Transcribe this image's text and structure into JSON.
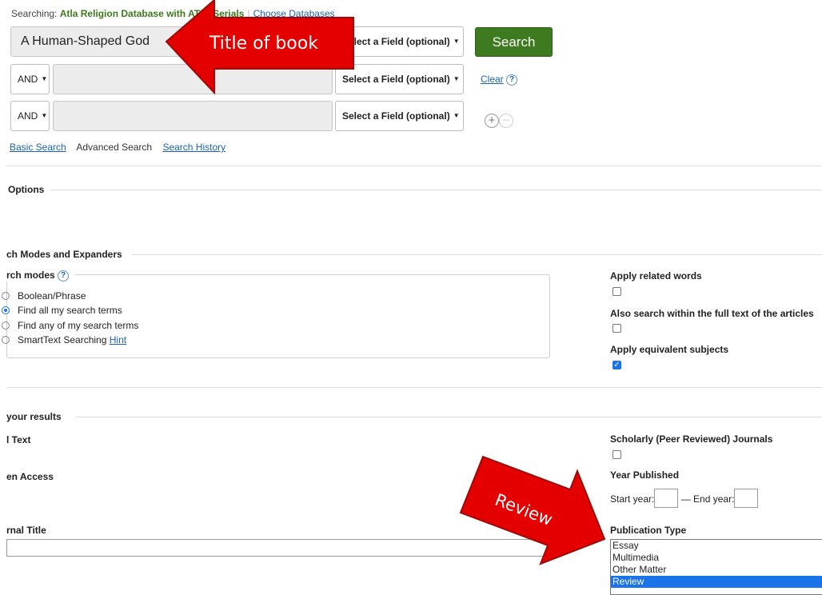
{
  "search_header": {
    "prefix": "Searching:",
    "database": "Atla Religion Database with ATLASerials",
    "choose_databases": "Choose Databases"
  },
  "rows": [
    {
      "term": "A Human-Shaped God",
      "field": "Select a Field (optional)"
    },
    {
      "operator": "AND",
      "term": "",
      "field": "Select a Field (optional)"
    },
    {
      "operator": "AND",
      "term": "",
      "field": "Select a Field (optional)"
    }
  ],
  "search_button": "Search",
  "clear_link": "Clear",
  "help_glyph": "?",
  "add_glyph": "+",
  "remove_glyph": "−",
  "caret_glyph": "▼",
  "nav": {
    "basic": "Basic Search",
    "advanced": "Advanced Search",
    "history": "Search History"
  },
  "options_heading": "Options",
  "modes_heading": "ch Modes and Expanders",
  "search_modes_label": "rch modes",
  "modes": [
    {
      "label": "Boolean/Phrase",
      "selected": false
    },
    {
      "label": "Find all my search terms",
      "selected": true
    },
    {
      "label": "Find any of my search terms",
      "selected": false
    },
    {
      "label": "SmartText Searching",
      "selected": false,
      "hint": "Hint"
    }
  ],
  "expanders": [
    {
      "label": "Apply related words",
      "checked": false
    },
    {
      "label": "Also search within the full text of the articles",
      "checked": false
    },
    {
      "label": "Apply equivalent subjects",
      "checked": true
    }
  ],
  "limit_heading": "your results",
  "limiters_left": {
    "full_text": "l Text",
    "open_access": "en Access",
    "journal_title": "rnal Title"
  },
  "scholarly": {
    "label": "Scholarly (Peer Reviewed) Journals",
    "checked": false
  },
  "year_published": {
    "label": "Year Published",
    "start": "Start year:",
    "end": "— End year:"
  },
  "publication_type": {
    "label": "Publication Type",
    "options": [
      "Essay",
      "Multimedia",
      "Other Matter",
      "Review"
    ],
    "selected": "Review"
  },
  "annotations": {
    "title_arrow": "Title of book",
    "review_arrow": "Review"
  },
  "colors": {
    "accent_green": "#3e7a1f",
    "link_blue": "#1a62b8",
    "selection_blue": "#1a73e8",
    "annotation_red": "#e50000"
  }
}
